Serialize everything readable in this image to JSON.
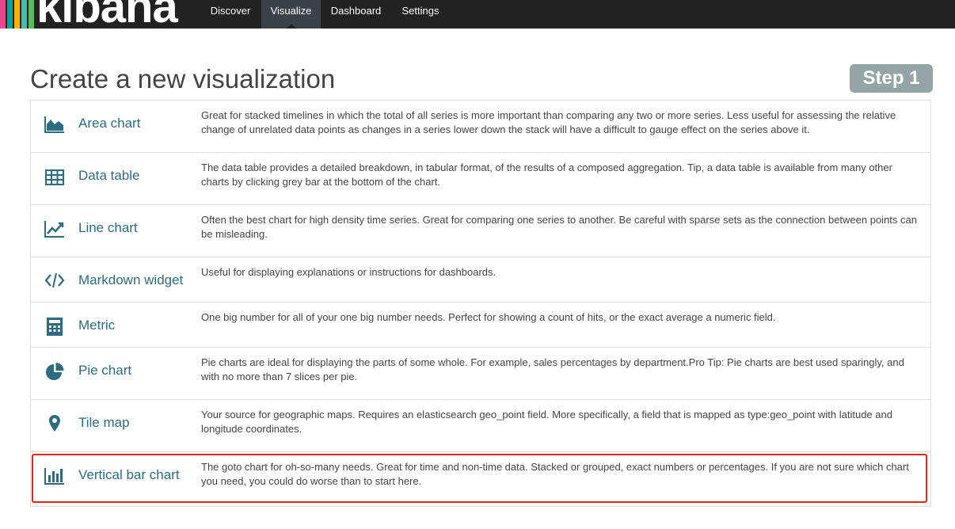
{
  "nav": {
    "logo_text": "kibana",
    "logo_colors": [
      "#e8478b",
      "#00a69b",
      "#f0b300",
      "#3ebeb0",
      "#5cb85c"
    ],
    "tabs": [
      {
        "label": "Discover"
      },
      {
        "label": "Visualize"
      },
      {
        "label": "Dashboard"
      },
      {
        "label": "Settings"
      }
    ],
    "active_tab": "Visualize"
  },
  "page": {
    "title": "Create a new visualization",
    "step_badge": "Step 1"
  },
  "accent_color": "#2c6b80",
  "highlight_color": "#e2231a",
  "visualizations": [
    {
      "icon": "area-chart-icon",
      "name": "Area chart",
      "description": "Great for stacked timelines in which the total of all series is more important than comparing any two or more series. Less useful for assessing the relative change of unrelated data points as changes in a series lower down the stack will have a difficult to gauge effect on the series above it."
    },
    {
      "icon": "table-icon",
      "name": "Data table",
      "description": "The data table provides a detailed breakdown, in tabular format, of the results of a composed aggregation. Tip, a data table is available from many other charts by clicking grey bar at the bottom of the chart."
    },
    {
      "icon": "line-chart-icon",
      "name": "Line chart",
      "description": "Often the best chart for high density time series. Great for comparing one series to another. Be careful with sparse sets as the connection between points can be misleading."
    },
    {
      "icon": "code-icon",
      "name": "Markdown widget",
      "description": "Useful for displaying explanations or instructions for dashboards."
    },
    {
      "icon": "calculator-icon",
      "name": "Metric",
      "description": "One big number for all of your one big number needs. Perfect for showing a count of hits, or the exact average a numeric field."
    },
    {
      "icon": "pie-chart-icon",
      "name": "Pie chart",
      "description": "Pie charts are ideal for displaying the parts of some whole. For example, sales percentages by department.Pro Tip: Pie charts are best used sparingly, and with no more than 7 slices per pie."
    },
    {
      "icon": "map-marker-icon",
      "name": "Tile map",
      "description": "Your source for geographic maps. Requires an elasticsearch geo_point field. More specifically, a field that is mapped as type:geo_point with latitude and longitude coordinates."
    },
    {
      "icon": "bar-chart-icon",
      "name": "Vertical bar chart",
      "description": "The goto chart for oh-so-many needs. Great for time and non-time data. Stacked or grouped, exact numbers or percentages. If you are not sure which chart you need, you could do worse than to start here.",
      "highlighted": true
    }
  ]
}
